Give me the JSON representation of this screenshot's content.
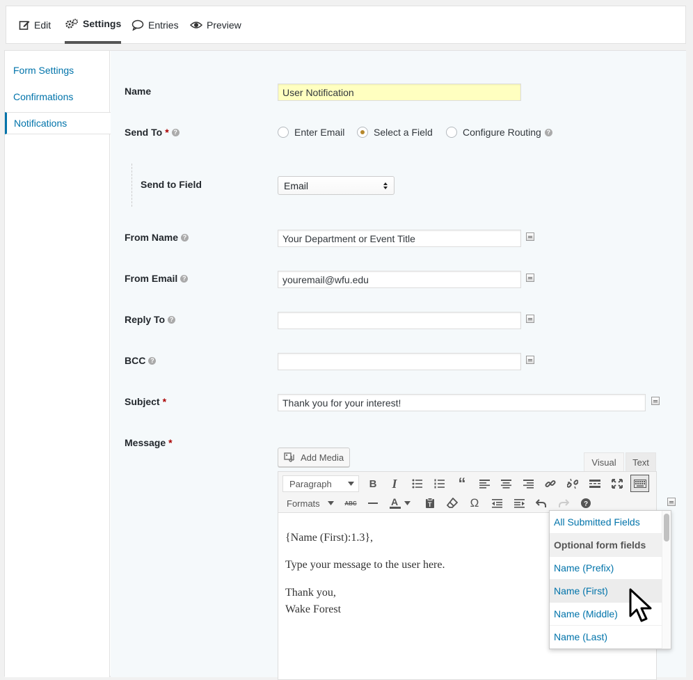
{
  "top_tabs": [
    {
      "label": "Edit",
      "icon": "edit-icon"
    },
    {
      "label": "Settings",
      "icon": "gears-icon",
      "active": true
    },
    {
      "label": "Entries",
      "icon": "comment-icon"
    },
    {
      "label": "Preview",
      "icon": "eye-icon"
    }
  ],
  "sidebar": {
    "items": [
      {
        "label": "Form Settings"
      },
      {
        "label": "Confirmations"
      },
      {
        "label": "Notifications",
        "active": true
      }
    ]
  },
  "form": {
    "name": {
      "label": "Name",
      "value": "User Notification"
    },
    "send_to": {
      "label": "Send To",
      "required": "*",
      "options": [
        "Enter Email",
        "Select a Field",
        "Configure Routing"
      ],
      "selected": "Select a Field"
    },
    "send_to_field": {
      "label": "Send to Field",
      "value": "Email"
    },
    "from_name": {
      "label": "From Name",
      "value": "Your Department or Event Title"
    },
    "from_email": {
      "label": "From Email",
      "value": "youremail@wfu.edu"
    },
    "reply_to": {
      "label": "Reply To",
      "value": ""
    },
    "bcc": {
      "label": "BCC",
      "value": ""
    },
    "subject": {
      "label": "Subject",
      "required": "*",
      "value": "Thank you for your interest!"
    },
    "message": {
      "label": "Message",
      "required": "*"
    }
  },
  "editor": {
    "add_media": "Add Media",
    "tab_visual": "Visual",
    "tab_text": "Text",
    "format_select": "Paragraph",
    "formats_menu": "Formats",
    "strikethrough_glyph": "ABC",
    "body": {
      "line1": "{Name (First):1.3},",
      "line2": "Type your message to the user here.",
      "line3": "Thank you,",
      "line4": "Wake Forest"
    }
  },
  "merge_dropdown": {
    "items": [
      {
        "label": "All Submitted Fields",
        "type": "item"
      },
      {
        "label": "Optional form fields",
        "type": "group"
      },
      {
        "label": "Name (Prefix)",
        "type": "item"
      },
      {
        "label": "Name (First)",
        "type": "item",
        "hover": true
      },
      {
        "label": "Name (Middle)",
        "type": "item"
      },
      {
        "label": "Name (Last)",
        "type": "item"
      }
    ]
  },
  "colors": {
    "link": "#0073aa",
    "required": "#aa0000",
    "name_field_bg": "#ffffc0",
    "content_bg": "#f5f9fb"
  }
}
